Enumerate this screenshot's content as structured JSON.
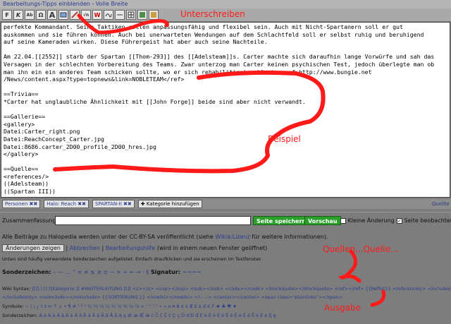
{
  "topbar": {
    "text": "Bearbeitungs-Tipps einblenden - Volle Breite"
  },
  "toolbar": {
    "buttons": [
      "F",
      "K",
      "Ab",
      "Ω",
      "A",
      "",
      "",
      "√n",
      "W",
      "",
      "",
      "",
      "",
      ""
    ]
  },
  "editor": {
    "lines": [
      "perfekte Kommandant. Seine Taktiken sollen anpassungsfähig und flexibel sein. Auch mit Nicht-Spartanern soll er gut",
      "auskommen und sie führen können. Auch bei unerwarteten Wendungen auf dem Schlachtfeld soll er selbst ruhig und beruhigend",
      "auf seine Kameraden wirken. Diese Führergeist hat aber auch seine Nachteile.",
      "",
      "Am 22.04.[[2552]] starb der Spartan [[Thom-293]] des [[Adelsteam]]s. Carter machte sich daraufhin lange Vorwürfe und sah das",
      "Versagen in der schlechten Vorbereitung des Teams. Zwar unterzog man Carter keinen psychischen Test, jedoch überlegte man ob",
      "man ihn ein ein anderes Team schicken sollte, wo er sich rehabilitierten könnte.<ref>http://www.bungie.net",
      "/News/content.aspx?type=topnews&link=NOBLETEAM</ref>",
      "",
      "==Trivia==",
      "*Carter hat unglaubliche Ähnlichkeit mit [[John Forge]] beide sind aber nicht verwandt.",
      "",
      "==Gallerie==",
      "<gallery>",
      "Datei:Carter_right.png",
      "Datei:ReachConcept_Carter.jpg",
      "Datei:8686.carter_2D00_profile_2D00_hres.jpg",
      "</gallery>",
      "",
      "==Quelle==",
      "<references/>",
      "((Adelsteam))",
      "((Spartan III))"
    ]
  },
  "categories": {
    "items": [
      "Personen ✖✖",
      "Halo: Reach ✖✖",
      "SPARTAN-II ✖✖"
    ],
    "add_label": "✚ Kategorie hinzufügen",
    "right_link": "Quellte"
  },
  "summary": {
    "label": "Zusammenfassung:",
    "save_label": "Seite speichern",
    "preview_label": "Vorschau",
    "minor_label": "Kleine Änderung",
    "watch_label": "Seite beobachten"
  },
  "license": {
    "prefix": "Alle Beiträge zu Halopedia werden unter der CC-BY-SA veröffentlicht (siehe ",
    "link": "Wikia:Lizenz",
    "suffix": " für weitere Informationen)."
  },
  "actions": {
    "show_changes": "Änderungen zeigen",
    "cancel": "Abbrechen",
    "help": "Bearbeitungshilfe",
    "help_note": "(wird in einem neuen Fenster geöffnet)"
  },
  "special_chars": {
    "hint": "Unten sind häufig verwendete Sonderzeichen aufgelistet. Einfach draufklicken und sie erscheinen im Textfenster.",
    "title_label": "Sonderzeichen:",
    "title_chars": "– — … ° ≈ ≠ ≤ ≥ ± − × ÷ ← → · §",
    "signature_label": "Signatur:",
    "signature_chars": "~~~~",
    "wiki_label": "Wiki Syntax:",
    "wiki_items": "[[]]  |  []  [[Kategorie:]]  #WEITERLEITUNG [[]]  <s></s>  <sup></sup>  <sub></sub>  <code></code>  <blockquote></blockquote>  <ref></ref>  {{Reflist}}  <references/>  <includeonly>",
    "wiki_items2": "</includeonly>  <noinclude></noinclude>  {{SORTIERUNG:}}  <nowiki></nowiki>  <!-- -->  <center></center>  <span class=\"plainlinks\"></span>",
    "symbols_label": "Symbole:",
    "symbols": "~ | ¡ ¿ † ‡ ↔ ↑ ↓ • ¶ # ¹ ² ³ ½ ⅓ ⅔ ¼ ¾ ⅛ ⅜ ⅝ ⅞ ∞ ‘ “ ’ ” « » ¤ ₳ ฿ ₵ ¢ ₡ ₢ $ ₫ € ₣ ♠ ♣ ♥ ♦",
    "chars_label": "Sonderzeichen:",
    "chars": "Á á À à Â â Ä ä Ǎ ǎ Ă ă Ā ā Ã ã Å å Ą ą Æ æ Ǣ ǣ ć Ĉ ĉ Č č Ç ç Ď ď Đ đ É é È è Ê ê Ë ë Ě ě Ĕ ĕ Ē ē Ė ė Ę ę"
  },
  "annotations": {
    "unterschreiben": "Unterschreiben",
    "beispiel": "Beispiel",
    "quellen": "Quellen...Quelle...",
    "ausgabe": "Ausgabe"
  },
  "colors": {
    "annotation": "#ff1a1a",
    "save": "#2aa02a",
    "link": "#2a3d8f"
  }
}
